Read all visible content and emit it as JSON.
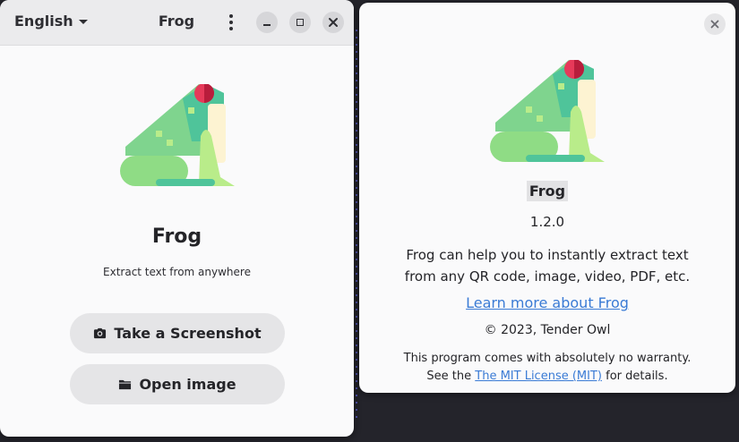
{
  "main_window": {
    "header": {
      "language": "English",
      "title": "Frog"
    },
    "app_name": "Frog",
    "tagline": "Extract text from anywhere",
    "buttons": {
      "screenshot_label": "Take a Screenshot",
      "open_image_label": "Open image"
    },
    "icons": {
      "menu": "kebab-menu-icon",
      "minimize": "minimize-icon",
      "maximize": "maximize-icon",
      "close": "close-icon",
      "camera": "camera-icon",
      "folder": "folder-icon"
    }
  },
  "about_window": {
    "app_name": "Frog",
    "version": "1.2.0",
    "comments_line1": "Frog can help you to instantly extract text",
    "comments_line2": "from any QR code, image, video, PDF, etc.",
    "website_label": "Learn more about Frog",
    "copyright": "© 2023, Tender Owl",
    "license_line1": "This program comes with absolutely no warranty.",
    "license_prefix": "See the",
    "license_link": "The MIT License (MIT)",
    "license_suffix": "for details."
  },
  "colors": {
    "link": "#3a7bd5",
    "frog_body": "#7fd48e",
    "frog_dark": "#4fc49a",
    "frog_belly": "#fdf3d2",
    "frog_leg": "#b9ec8a",
    "frog_eye": "#e63a5a"
  }
}
